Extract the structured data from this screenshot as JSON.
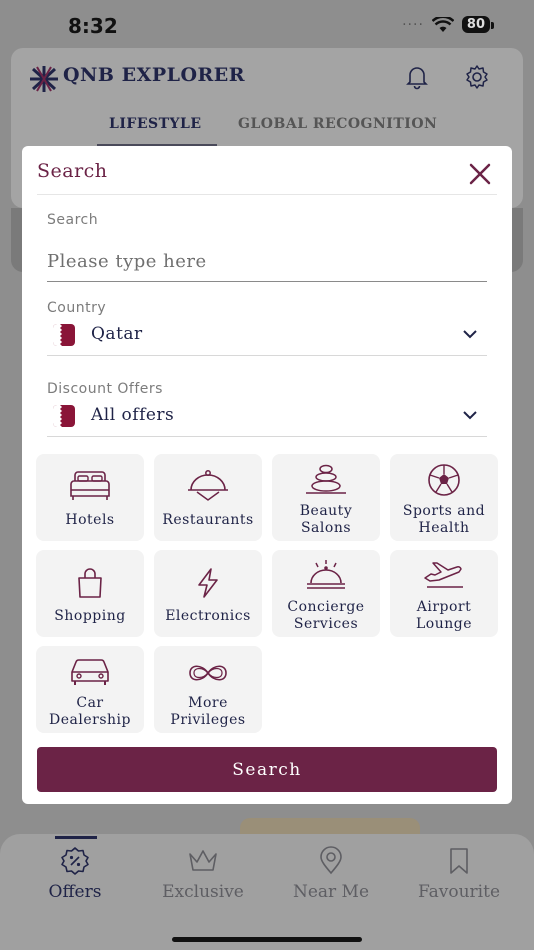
{
  "status_bar": {
    "time": "8:32",
    "signal": "····",
    "battery": "80"
  },
  "header": {
    "app_title": "QNB EXPLORER",
    "tabs": [
      {
        "label": "LIFESTYLE",
        "active": true
      },
      {
        "label": "GLOBAL RECOGNITION",
        "active": false
      }
    ],
    "icons": [
      "bell-icon",
      "gear-icon"
    ]
  },
  "modal": {
    "title": "Search",
    "search": {
      "label": "Search",
      "placeholder": "Please type here",
      "value": ""
    },
    "country": {
      "label": "Country",
      "value": "Qatar",
      "flag": "qatar-flag"
    },
    "discount": {
      "label": "Discount Offers",
      "value": "All offers",
      "flag": "qatar-flag"
    },
    "categories": [
      {
        "label": "Hotels",
        "icon": "bed-icon"
      },
      {
        "label": "Restaurants",
        "icon": "cloche-icon"
      },
      {
        "label": "Beauty\nSalons",
        "icon": "spa-stones-icon"
      },
      {
        "label": "Sports and\nHealth",
        "icon": "soccer-ball-icon"
      },
      {
        "label": "Shopping",
        "icon": "shopping-bag-icon"
      },
      {
        "label": "Electronics",
        "icon": "lightning-icon"
      },
      {
        "label": "Concierge\nServices",
        "icon": "service-bell-icon"
      },
      {
        "label": "Airport\nLounge",
        "icon": "airplane-icon"
      },
      {
        "label": "Car\nDealership",
        "icon": "car-icon"
      },
      {
        "label": "More\nPrivileges",
        "icon": "infinity-icon"
      }
    ],
    "search_button": "Search"
  },
  "bottom_nav": {
    "items": [
      {
        "label": "Offers",
        "icon": "offer-badge-icon",
        "active": true
      },
      {
        "label": "Exclusive",
        "icon": "crown-icon",
        "active": false
      },
      {
        "label": "Near Me",
        "icon": "location-pin-icon",
        "active": false
      },
      {
        "label": "Favourite",
        "icon": "bookmark-icon",
        "active": false
      }
    ]
  },
  "colors": {
    "brand": "#6b2346",
    "navy": "#1f2347",
    "overlay": "#8e8e8e"
  }
}
